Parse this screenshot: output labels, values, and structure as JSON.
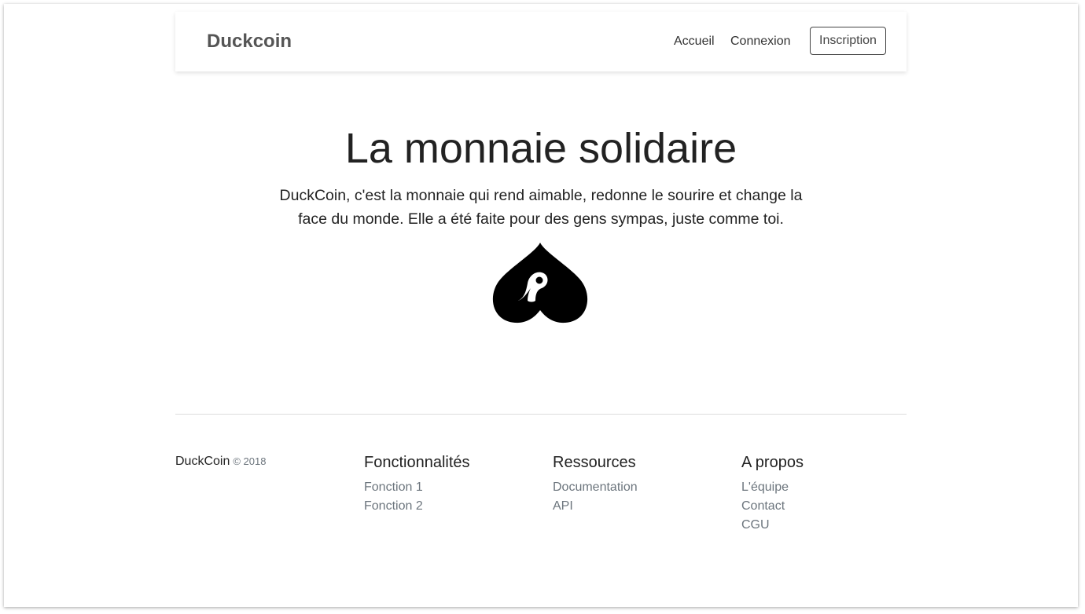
{
  "navbar": {
    "brand": "Duckcoin",
    "links": [
      "Accueil",
      "Connexion"
    ],
    "signup": "Inscription"
  },
  "hero": {
    "title": "La monnaie solidaire",
    "text": "DuckCoin, c'est la monnaie qui rend aimable, redonne le sourire et change la face du monde. Elle a été faite pour des gens sympas, juste comme toi.",
    "logo_icon": "duck-spade-logo-icon"
  },
  "footer": {
    "brand": "DuckCoin",
    "year": "© 2018",
    "columns": [
      {
        "title": "Fonctionnalités",
        "links": [
          "Fonction 1",
          "Fonction 2"
        ]
      },
      {
        "title": "Ressources",
        "links": [
          "Documentation",
          "API"
        ]
      },
      {
        "title": "A propos",
        "links": [
          "L'équipe",
          "Contact",
          "CGU"
        ]
      }
    ]
  }
}
